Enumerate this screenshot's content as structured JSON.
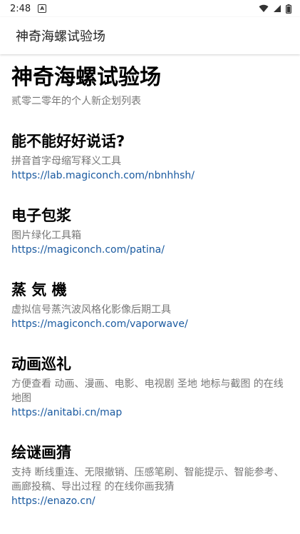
{
  "status_bar": {
    "time": "2:48",
    "notification_glyph": "A",
    "icons": [
      "wifi-icon",
      "signal-icon",
      "battery-icon"
    ]
  },
  "app_bar": {
    "title": "神奇海螺试验场"
  },
  "header": {
    "title": "神奇海螺试验场",
    "subtitle": "贰零二零年的个人新企划列表"
  },
  "projects": [
    {
      "title": "能不能好好说话?",
      "description": "拼音首字母缩写释义工具",
      "url": "https://lab.magiconch.com/nbnhhsh/"
    },
    {
      "title": "电子包浆",
      "description": "图片绿化工具箱",
      "url": "https://magiconch.com/patina/"
    },
    {
      "title": "蒸 気 機",
      "description": "虚拟信号蒸汽波风格化影像后期工具",
      "url": "https://magiconch.com/vaporwave/"
    },
    {
      "title": "动画巡礼",
      "description": "方便查看 动画、漫画、电影、电视剧 圣地 地标与截图 的在线地图",
      "url": "https://anitabi.cn/map"
    },
    {
      "title": "绘谜画猜",
      "description": "支持 断线重连、无限撤销、压感笔刷、智能提示、智能参考、画廊投稿、导出过程 的在线你画我猜",
      "url": "https://enazo.cn/"
    }
  ],
  "colors": {
    "link": "#1a5aa0",
    "muted_text": "#777777",
    "background": "#ffffff"
  }
}
